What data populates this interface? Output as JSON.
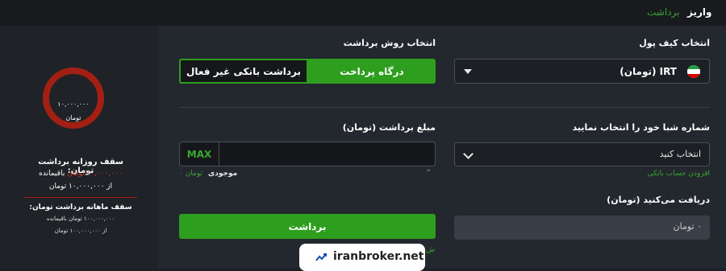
{
  "top_tabs": {
    "deposit": "واریز",
    "withdraw": "برداشت"
  },
  "wallet": {
    "label": "انتخاب کیف پول",
    "selected": "IRT (تومان)"
  },
  "method": {
    "label": "انتخاب روش برداشت",
    "gateway": "درگاه پرداخت",
    "inactive_bank": "برداشت بانکی غیر فعال"
  },
  "iban": {
    "label": "شماره شبا خود را انتخاب نمایید",
    "placeholder": "انتخاب کنید",
    "add_account": "افزودن حساب بانکی"
  },
  "amount": {
    "label": "مبلغ برداشت (تومان)",
    "max": "MAX",
    "balance_label": "موجودی",
    "balance_value": "۰ تومان",
    "dash": "–"
  },
  "receive": {
    "label": "دریافت می‌کنید (تومان)",
    "value": "۰ تومان"
  },
  "withdraw_button": "برداشت",
  "limits": {
    "gauge_value": "۱۰,۰۰۰,۰۰۰",
    "gauge_unit": "تومان",
    "gauge_fraction_remaining": 1.0,
    "daily_title": "سقف روزانه برداشت تومان:",
    "daily_remaining_value": "۱۰,۰۰۰,۰۰۰",
    "daily_remaining_unit": "تومان",
    "daily_remaining_word": "باقیمانده",
    "daily_of": "از ۱۰,۰۰۰,۰۰۰ تومان",
    "monthly_title": "سقف ماهانه برداشت تومان:",
    "monthly_remaining": "۱۰۰,۰۰۰,۰۰۰ تومان باقیمانده",
    "monthly_of": "از ۱۰۰,۰۰۰,۰۰۰ تومان"
  },
  "watermark": "iranbroker.net",
  "partial_text": "ش",
  "colors": {
    "accent": "#2e9e1e",
    "gauge": "#a31f14",
    "bg": "#23272e"
  }
}
